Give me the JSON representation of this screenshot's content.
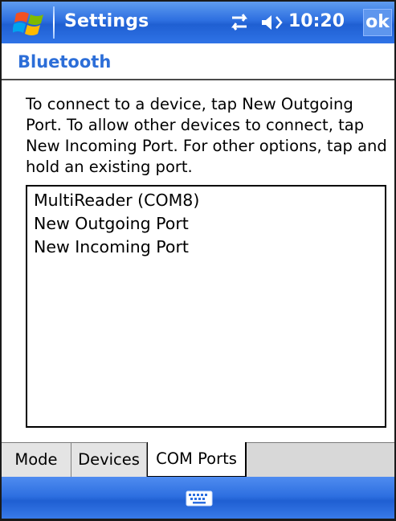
{
  "titlebar": {
    "app_title": "Settings",
    "clock": "10:20",
    "ok_label": "ok",
    "start_icon": "windows-flag-icon",
    "connectivity_icon": "sync-arrows-icon",
    "volume_icon": "speaker-icon"
  },
  "header": {
    "title": "Bluetooth"
  },
  "description": "To connect to a device, tap New Outgoing Port. To allow other devices to connect, tap New Incoming Port. For other options, tap and hold an existing port.",
  "ports": [
    "MultiReader (COM8)",
    "New Outgoing Port",
    "New Incoming Port"
  ],
  "tabs": {
    "mode": "Mode",
    "devices": "Devices",
    "com_ports": "COM Ports",
    "active": "COM Ports"
  },
  "bottombar": {
    "input_icon": "keyboard-icon"
  },
  "colors": {
    "titlebar_blue": "#2d6fe0",
    "header_text": "#2c6ed8"
  }
}
